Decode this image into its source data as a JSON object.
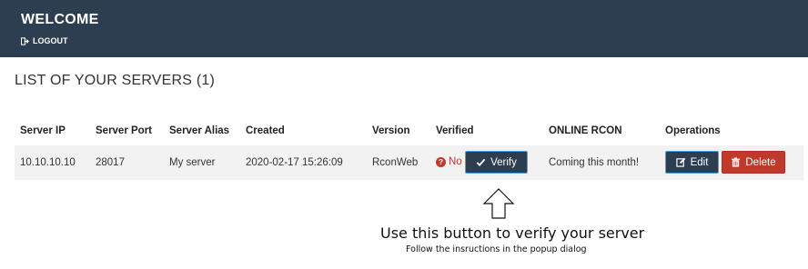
{
  "header": {
    "title": "WELCOME",
    "logout_label": "LOGOUT",
    "background": "#2c3e50"
  },
  "section": {
    "title": "LIST OF YOUR SERVERS (1)"
  },
  "table": {
    "columns": [
      "Server IP",
      "Server Port",
      "Server Alias",
      "Created",
      "Version",
      "Verified",
      "ONLINE RCON",
      "Operations"
    ],
    "rows": [
      {
        "server_ip": "10.10.10.10",
        "server_port": "28017",
        "server_alias": "My server",
        "created": "2020-02-17 15:26:09",
        "version": "RconWeb",
        "verified": "No",
        "verify_label": "Verify",
        "online_rcon": "Coming this month!",
        "edit_label": "Edit",
        "delete_label": "Delete"
      }
    ]
  },
  "callout": {
    "main": "Use this button to verify your server",
    "sub": "Follow the insructions in the popup dialog"
  },
  "icons": {
    "logout": "logout-icon",
    "question": "question-circle-icon",
    "verify": "check-icon",
    "edit": "edit-icon",
    "delete": "trash-icon",
    "arrow": "arrow-up-icon"
  },
  "colors": {
    "dark": "#2c3e50",
    "accent_border": "#4aa3df",
    "danger": "#c0392b",
    "row_bg": "#f2f2f2"
  }
}
